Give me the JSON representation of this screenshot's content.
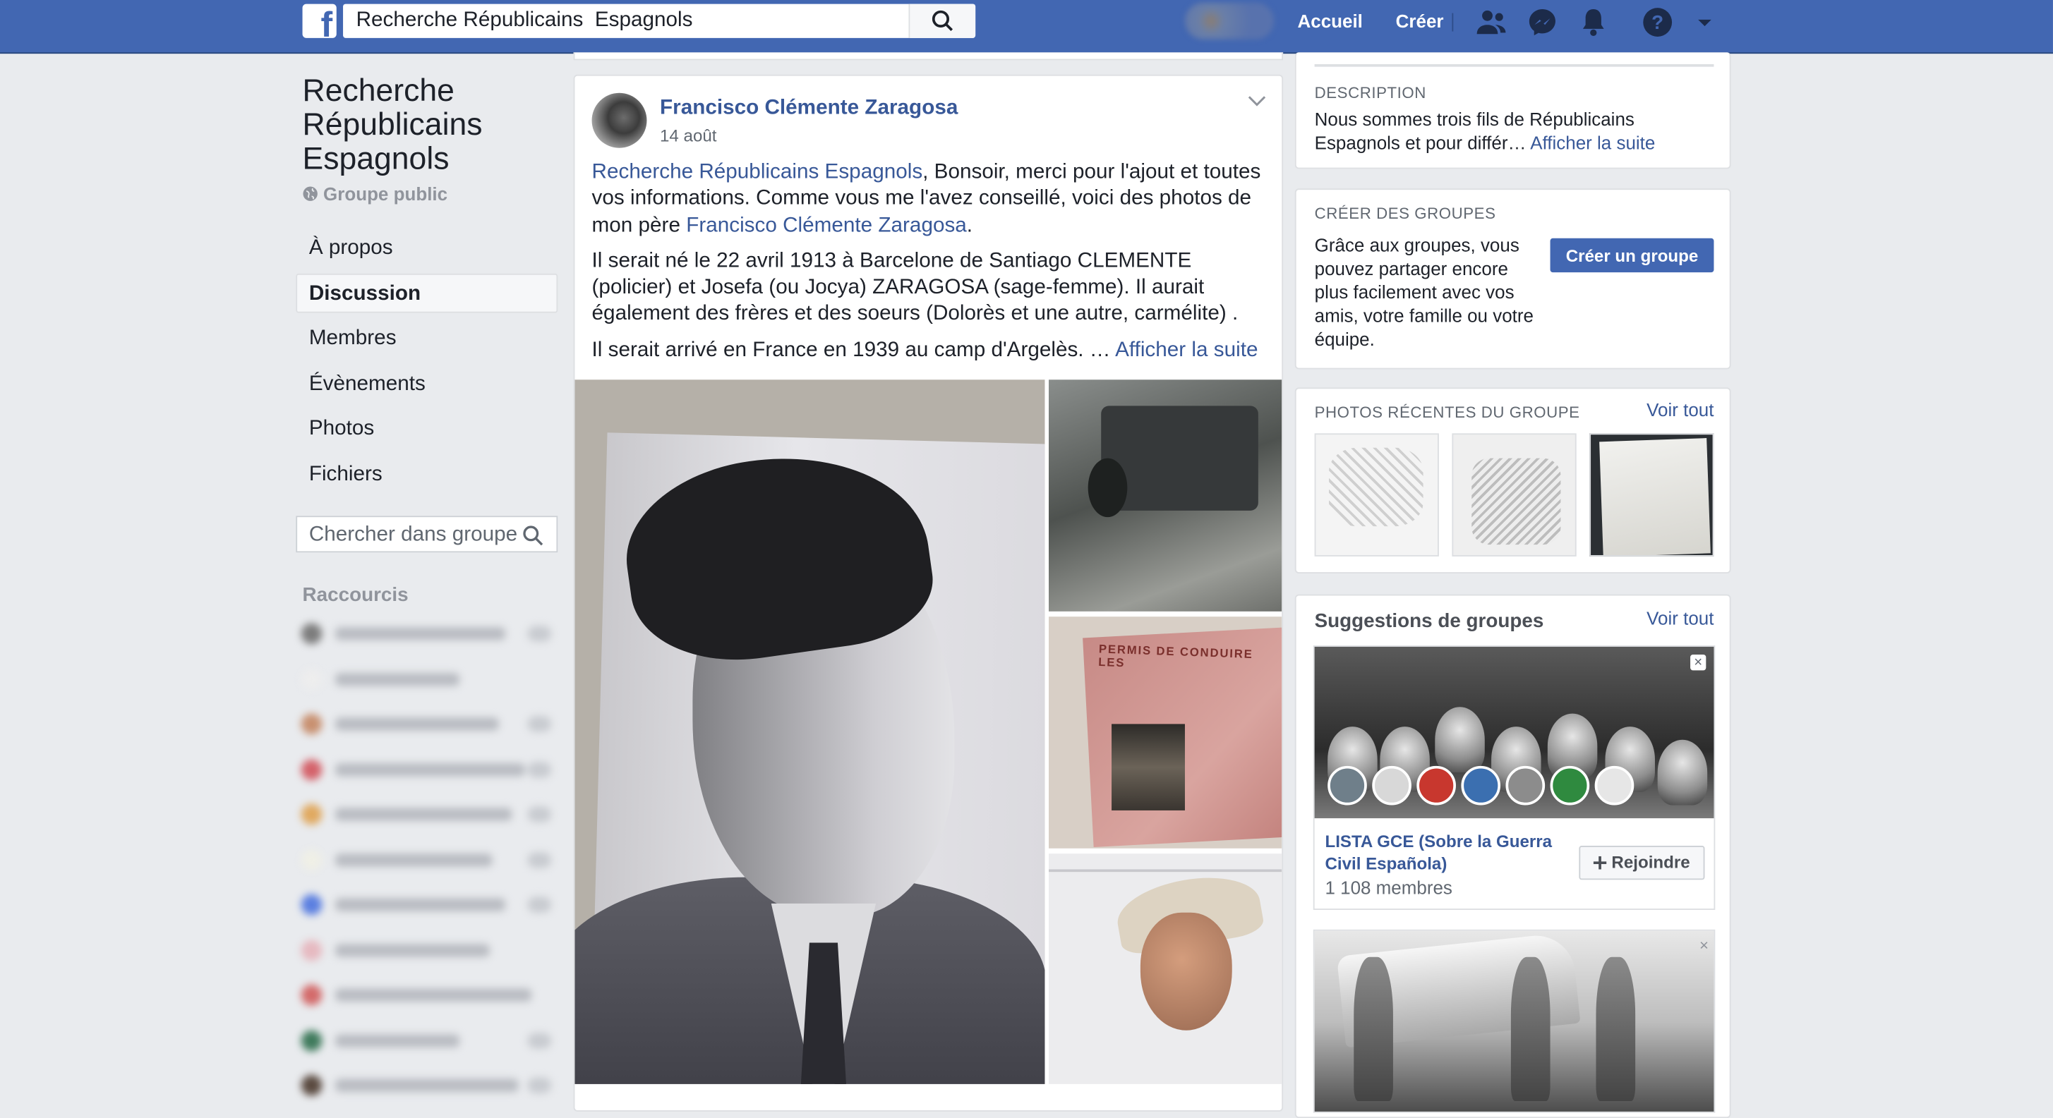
{
  "topbar": {
    "logo_letter": "f",
    "search_value": "Recherche Républicains  Espagnols",
    "nav_home": "Accueil",
    "nav_create": "Créer"
  },
  "group": {
    "name_line1": "Recherche",
    "name_line2": "Républicains",
    "name_line3": "Espagnols",
    "type_icon": "globe-icon",
    "type": "Groupe public"
  },
  "left_nav": {
    "items": [
      {
        "label": "À propos"
      },
      {
        "label": "Discussion"
      },
      {
        "label": "Membres"
      },
      {
        "label": "Évènements"
      },
      {
        "label": "Photos"
      },
      {
        "label": "Fichiers"
      }
    ],
    "active": "Discussion",
    "search_placeholder": "Chercher dans groupe",
    "shortcuts_title": "Raccourcis"
  },
  "post": {
    "author": "Francisco Clémente Zaragosa",
    "date": "14 août",
    "p1_group_link": "Recherche Républicains Espagnols",
    "p1_text": ", Bonsoir, merci pour l'ajout et toutes vos informations. Comme vous me l'avez conseillé, voici des photos de mon père ",
    "p1_person_link": "Francisco Clémente Zaragosa",
    "p1_end": ".",
    "p2": "Il serait né le 22 avril 1913 à Barcelone de Santiago CLEMENTE (policier) et Josefa (ou Jocya) ZARAGOSA (sage-femme). Il aurait également des frères et des soeurs (Dolorès et une autre, carmélite) .",
    "p3": "Il serait arrivé en France en 1939 au camp d'Argelès. … ",
    "see_more": "Afficher la suite",
    "card_stamp": "PERMIS DE CONDUIRE LES"
  },
  "right": {
    "description_label": "DESCRIPTION",
    "description_text": "Nous sommes trois fils de Républicains Espagnols et pour différ… ",
    "description_more": "Afficher la suite",
    "create_label": "CRÉER DES GROUPES",
    "create_text": "Grâce aux groupes, vous pouvez partager encore plus facilement avec vos amis, votre famille ou votre équipe.",
    "create_button": "Créer un groupe",
    "photos_label": "PHOTOS RÉCENTES DU GROUPE",
    "see_all": "Voir tout",
    "suggestions_title": "Suggestions de groupes",
    "suggestion1_name": "LISTA GCE (Sobre la Guerra Civil Española)",
    "suggestion1_members": "1 108 membres",
    "join_button": "Rejoindre",
    "close_symbol": "×"
  },
  "colors": {
    "brand": "#4267b2",
    "link": "#385898",
    "page_bg": "#e9ebee"
  }
}
